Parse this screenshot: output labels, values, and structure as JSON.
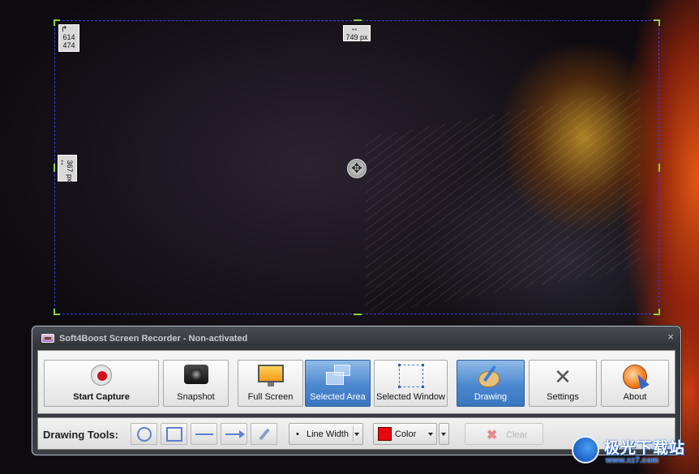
{
  "selection": {
    "size_width": "614",
    "size_height": "474",
    "width_label": "749 px",
    "height_label": "367 px"
  },
  "window": {
    "title": "Soft4Boost Screen Recorder - Non-activated",
    "close_glyph": "×"
  },
  "toolbar": {
    "buttons": [
      {
        "label": "Start Capture",
        "icon": "record-icon"
      },
      {
        "label": "Snapshot",
        "icon": "camera-icon"
      },
      {
        "label": "Full Screen",
        "icon": "monitor-icon"
      },
      {
        "label": "Selected Area",
        "icon": "area-icon",
        "active": true
      },
      {
        "label": "Selected Window",
        "icon": "window-icon"
      },
      {
        "label": "Drawing",
        "icon": "palette-icon",
        "active": true
      },
      {
        "label": "Settings",
        "icon": "tools-icon"
      },
      {
        "label": "About",
        "icon": "about-icon"
      }
    ]
  },
  "drawing_tools": {
    "label": "Drawing Tools:",
    "tools": [
      "ellipse-tool-icon",
      "rectangle-tool-icon",
      "line-tool-icon",
      "arrow-tool-icon",
      "pencil-tool-icon"
    ],
    "line_width_label": "Line Width",
    "line_width_bullet": "•",
    "color_label": "Color",
    "color_value": "#e8070c",
    "clear_label": "Clear"
  },
  "watermark": {
    "text": "极光下载站",
    "url": "www.xz7.com"
  }
}
